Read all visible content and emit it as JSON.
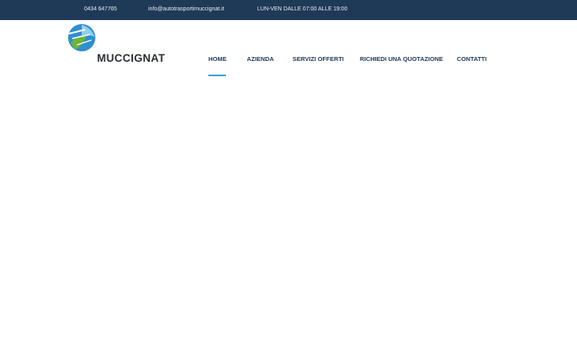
{
  "topbar": {
    "phone": "0434 647765",
    "email": "info@autotrasportimuccignat.it",
    "hours": "LUN-VEN DALLE 07:00 ALLE 19:00"
  },
  "logo": {
    "text": "MUCCIGNAT"
  },
  "nav": {
    "home": "HOME",
    "azienda": "AZIENDA",
    "servizi": "SERVIZI OFFERTI",
    "quotazione": "RICHIEDI UNA QUOTAZIONE",
    "contatti": "CONTATTI"
  },
  "colors": {
    "topbar_bg": "#1f3a56",
    "nav_text": "#1f3a56",
    "active_underline": "#3aa0d3"
  }
}
